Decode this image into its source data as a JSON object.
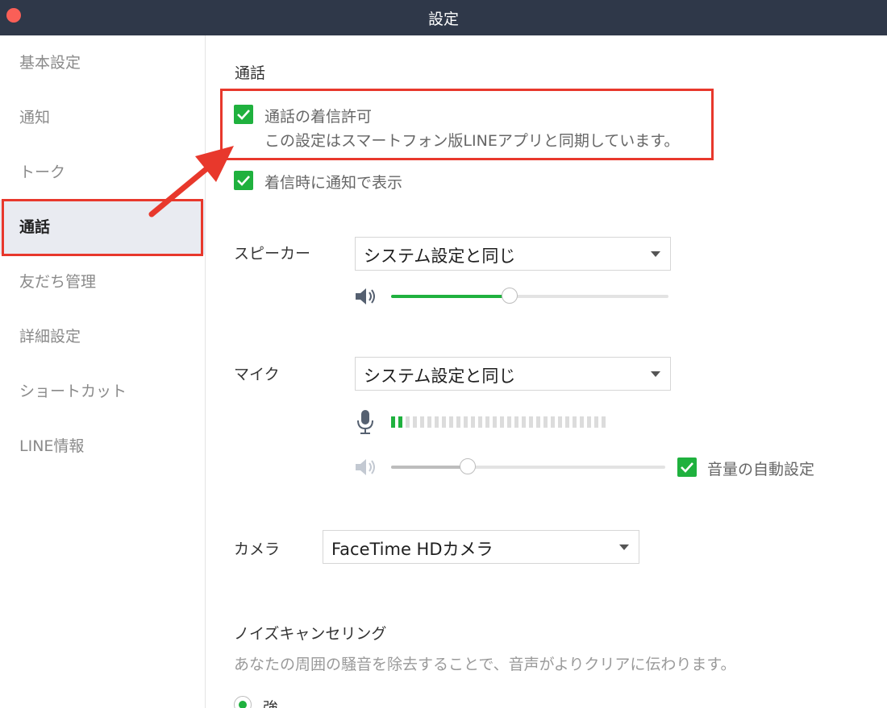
{
  "window": {
    "title": "設定"
  },
  "sidebar": {
    "items": [
      {
        "label": "基本設定"
      },
      {
        "label": "通知"
      },
      {
        "label": "トーク"
      },
      {
        "label": "通話",
        "active": true
      },
      {
        "label": "友だち管理"
      },
      {
        "label": "詳細設定"
      },
      {
        "label": "ショートカット"
      },
      {
        "label": "LINE情報"
      }
    ]
  },
  "call": {
    "section_title": "通話",
    "allow_incoming": {
      "checked": true,
      "label": "通話の着信許可",
      "description": "この設定はスマートフォン版LINEアプリと同期しています。"
    },
    "notify_on_incoming": {
      "checked": true,
      "label": "着信時に通知で表示"
    },
    "speaker": {
      "label": "スピーカー",
      "selected": "システム設定と同じ",
      "volume": 0.45
    },
    "mic": {
      "label": "マイク",
      "selected": "システム設定と同じ",
      "level_active_bars": 2,
      "level_total_bars": 30,
      "volume": 0.3,
      "auto_volume": {
        "checked": true,
        "label": "音量の自動設定"
      }
    },
    "camera": {
      "label": "カメラ",
      "selected": "FaceTime HDカメラ"
    },
    "noise_cancelling": {
      "title": "ノイズキャンセリング",
      "description": "あなたの周囲の騒音を除去することで、音声がよりクリアに伝わります。",
      "option_strong": "強"
    }
  },
  "colors": {
    "accent_green": "#1fb13e",
    "annotation_red": "#e8382c",
    "titlebar": "#2f3849"
  },
  "icons": {
    "speaker": "speaker-icon",
    "mic": "microphone-icon",
    "close": "close-window-icon",
    "check": "checkmark-icon",
    "dropdown": "chevron-down-icon"
  }
}
